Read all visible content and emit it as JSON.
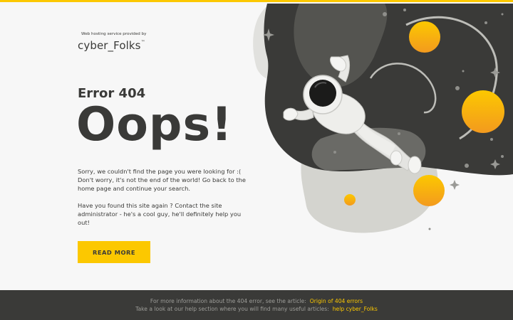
{
  "brand": {
    "provided_by": "Web hosting service provided by",
    "logo_text": "cyber_Folks",
    "logo_tm": "™"
  },
  "main": {
    "error_code": "Error 404",
    "headline": "Oops!",
    "para1": "Sorry, we couldn't find the page you were looking for :( Don't worry, it's not the end of the world! Go back to the home page and continue your search.",
    "para2": "Have you found this site again ? Contact the site administrator - he's a cool guy, he'll definitely help you out!",
    "button_label": "READ MORE"
  },
  "footer": {
    "line1_text": "For more information about the 404 error, see the article:",
    "line1_link": "Origin of 404 errors",
    "line2_text": "Take a look at our help section where you will find many useful articles:",
    "line2_link": "help cyber_Folks"
  },
  "colors": {
    "accent": "#fcc800",
    "dark": "#3a3a38",
    "background": "#f7f7f7"
  }
}
